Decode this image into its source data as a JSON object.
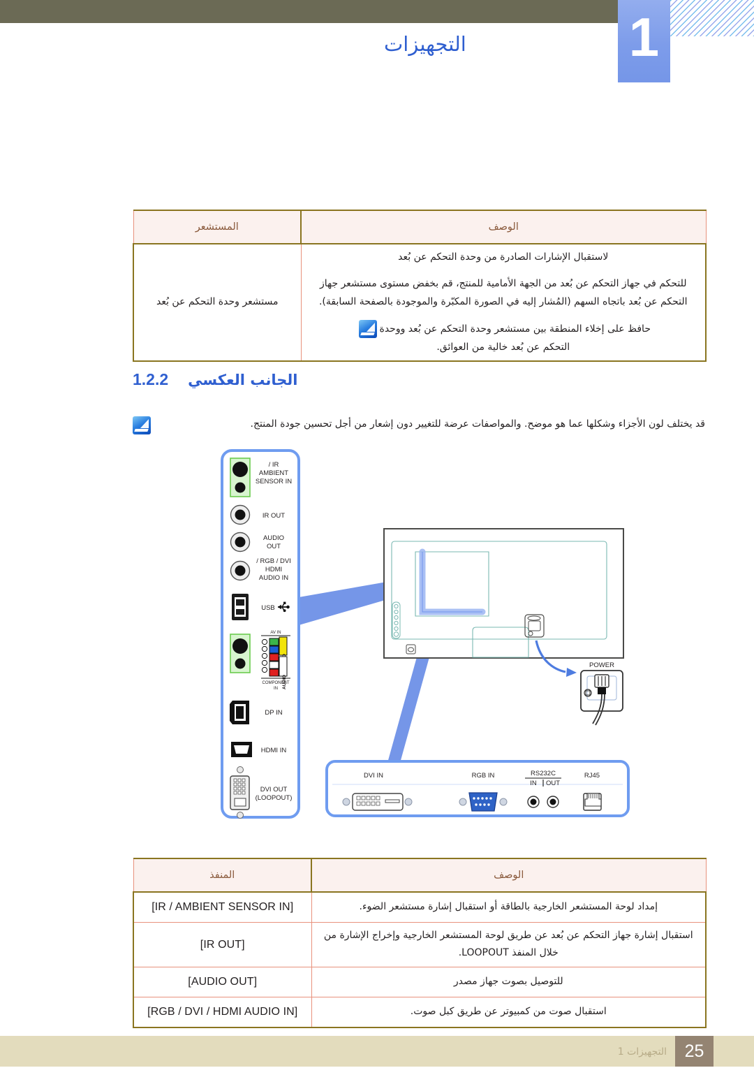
{
  "header": {
    "chapter_number": "1",
    "chapter_title": "التجهيزات"
  },
  "sensor_table": {
    "headers": {
      "description": "الوصف",
      "sensor": "المستشعر"
    },
    "row": {
      "sensor": "مستشعر وحدة التحكم عن بُعد",
      "desc_line1": "لاستقبال الإشارات الصادرة من وحدة التحكم عن بُعد",
      "desc_line2": "للتحكم في جهاز التحكم عن بُعد من الجهة الأمامية للمنتج، قم بخفض مستوى مستشعر جهاز التحكم عن بُعد باتجاه السهم (المُشار إليه في الصورة المكبّرة والموجودة بالصفحة السابقة).",
      "desc_note_a": "حافظ على إخلاء المنطقة بين مستشعر وحدة التحكم عن بُعد ووحدة",
      "desc_note_b": "التحكم عن بُعد خالية من العوائق."
    }
  },
  "section": {
    "number": "1.2.2",
    "title": "الجانب العكسي",
    "note": "قد يختلف لون الأجزاء وشكلها عما هو موضح. والمواصفات عرضة للتغيير دون إشعار من أجل تحسين جودة المنتج."
  },
  "diagram": {
    "side_panel_ports": [
      "IR / AMBIENT SENSOR IN",
      "IR OUT",
      "AUDIO OUT",
      "RGB / DVI / HDMI AUDIO IN",
      "USB",
      "AV IN",
      "COMPONENT IN",
      "DP IN",
      "HDMI IN",
      "DVI OUT (LOOPOUT)"
    ],
    "labels": {
      "ir_ambient_sensor_in_l1": "IR /",
      "ir_ambient_sensor_in_l2": "AMBIENT",
      "ir_ambient_sensor_in_l3": "SENSOR IN",
      "ir_out": "IR OUT",
      "audio_out_l1": "AUDIO",
      "audio_out_l2": "OUT",
      "rgb_dvi_hdmi_l1": "RGB / DVI /",
      "rgb_dvi_hdmi_l2": "HDMI",
      "rgb_dvi_hdmi_l3": "AUDIO IN",
      "usb": "USB",
      "av_in": "AV IN",
      "video": "VIDEO",
      "audio": "AUDIO",
      "component_in_l1": "COMPONENT",
      "component_in_l2": "IN",
      "dp_in": "DP IN",
      "hdmi_in": "HDMI IN",
      "dvi_out_l1": "DVI OUT",
      "dvi_out_l2": "(LOOPOUT)",
      "power": "POWER",
      "dvi_in": "DVI IN",
      "rgb_in": "RGB IN",
      "rs232c": "RS232C",
      "rs232c_in": "IN",
      "rs232c_out": "OUT",
      "rj45": "RJ45"
    },
    "colors": {
      "panel_outline": "#6f9cf0",
      "callout_arrow": "#7596e8",
      "sensor_highlight": "#8ce07a",
      "component_green": "#3bb54a",
      "component_blue": "#1b5fd4",
      "component_red": "#e02020",
      "audio_white": "#ffffff",
      "audio_red": "#e02020",
      "video_yellow": "#f2e40a",
      "connector_blue": "#2f63c6",
      "tv_body_outline": "#4a4a48",
      "tv_inner_line": "#7ab8b2"
    }
  },
  "port_table": {
    "headers": {
      "description": "الوصف",
      "port": "المنفذ"
    },
    "rows": [
      {
        "port": "[IR / AMBIENT SENSOR IN]",
        "description": "إمداد لوحة المستشعر الخارجية بالطاقة أو استقبال إشارة مستشعر الضوء."
      },
      {
        "port": "[IR OUT]",
        "description": "استقبال إشارة جهاز التحكم عن بُعد عن طريق لوحة المستشعر الخارجية وإخراج الإشارة من خلال المنفذ LOOPOUT."
      },
      {
        "port": "[AUDIO OUT]",
        "description": "للتوصيل بصوت جهاز مصدر"
      },
      {
        "port": "[RGB / DVI / HDMI AUDIO IN]",
        "description": "استقبال صوت من كمبيوتر عن طريق كبل صوت."
      }
    ]
  },
  "footer": {
    "label": "التجهيزات 1",
    "page_number": "25"
  }
}
